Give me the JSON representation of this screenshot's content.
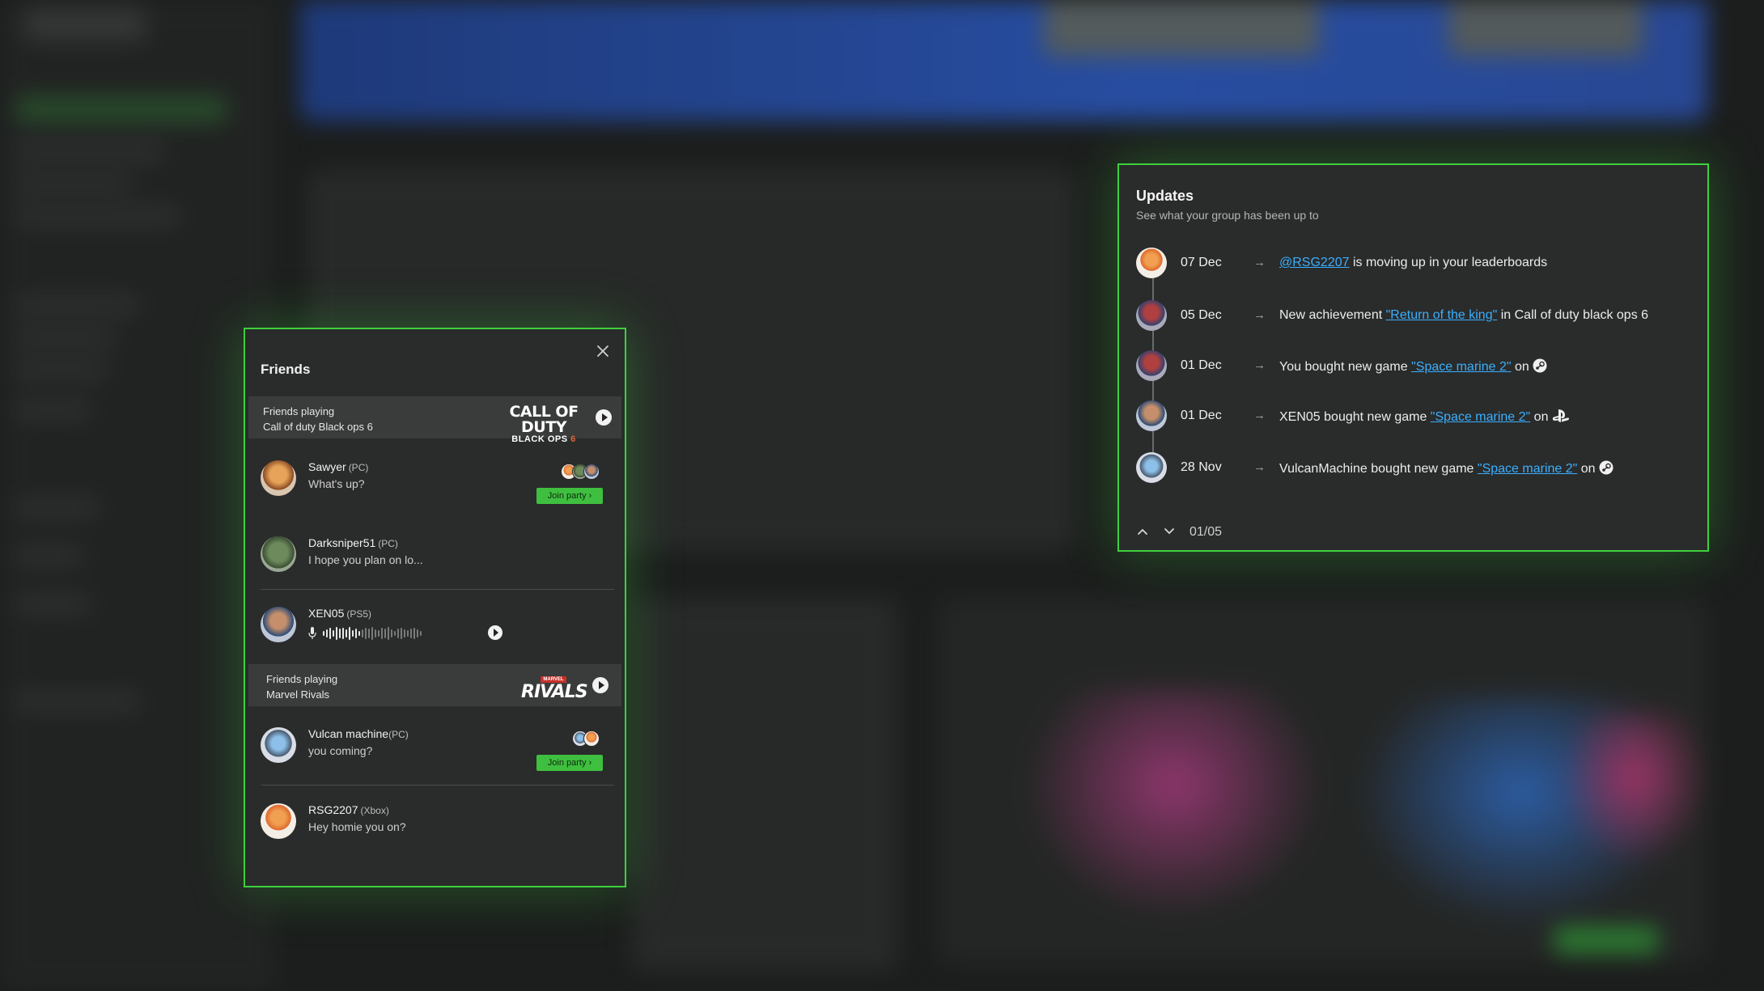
{
  "friends_panel": {
    "title": "Friends",
    "groups": [
      {
        "heading": "Friends playing",
        "game": "Call of duty Black ops 6",
        "logo_line1": "CALL OF DUTY",
        "logo_line2": "BLACK OPS",
        "logo_num": "6"
      },
      {
        "heading": "Friends playing",
        "game": "Marvel Rivals",
        "logo_top": "MARVEL",
        "logo_main": "RIVALS"
      }
    ],
    "friends": [
      {
        "name": "Sawyer",
        "platform": "(PC)",
        "message": "What's up?",
        "join_label": "Join party ›"
      },
      {
        "name": "Darksniper51",
        "platform": "(PC)",
        "message": "I hope you plan on lo..."
      },
      {
        "name": "XEN05",
        "platform": "(PS5)"
      },
      {
        "name": "Vulcan machine",
        "platform": "(PC)",
        "message": "you coming?",
        "join_label": "Join party ›"
      },
      {
        "name": "RSG2207",
        "platform": "(Xbox)",
        "message": "Hey homie you on?"
      }
    ]
  },
  "updates_panel": {
    "title": "Updates",
    "subtitle": "See what your group has been up to",
    "arrow": "→",
    "items": [
      {
        "date": "07 Dec",
        "link": "@RSG2207",
        "after": " is moving up in your leaderboards",
        "platform_icon": ""
      },
      {
        "date": "05 Dec",
        "before": "New achievement ",
        "link": "\"Return of the king\"",
        "after": " in Call of duty black ops 6",
        "platform_icon": ""
      },
      {
        "date": "01 Dec",
        "before": "You bought new game ",
        "link": "\"Space marine 2\"",
        "after": " on",
        "platform_icon": "steam-icon"
      },
      {
        "date": "01 Dec",
        "before": "XEN05 bought new game ",
        "link": "\"Space marine 2\"",
        "after": " on",
        "platform_icon": "playstation-icon"
      },
      {
        "date": "28 Nov",
        "before": "VulcanMachine bought new game ",
        "link": "\"Space marine 2\"",
        "after": " on",
        "platform_icon": "steam-icon"
      }
    ],
    "pager": "01/05"
  },
  "colors": {
    "accent_green": "#3ed03e",
    "link_blue": "#3ab0ff",
    "panel_bg": "#2a2b2b"
  }
}
